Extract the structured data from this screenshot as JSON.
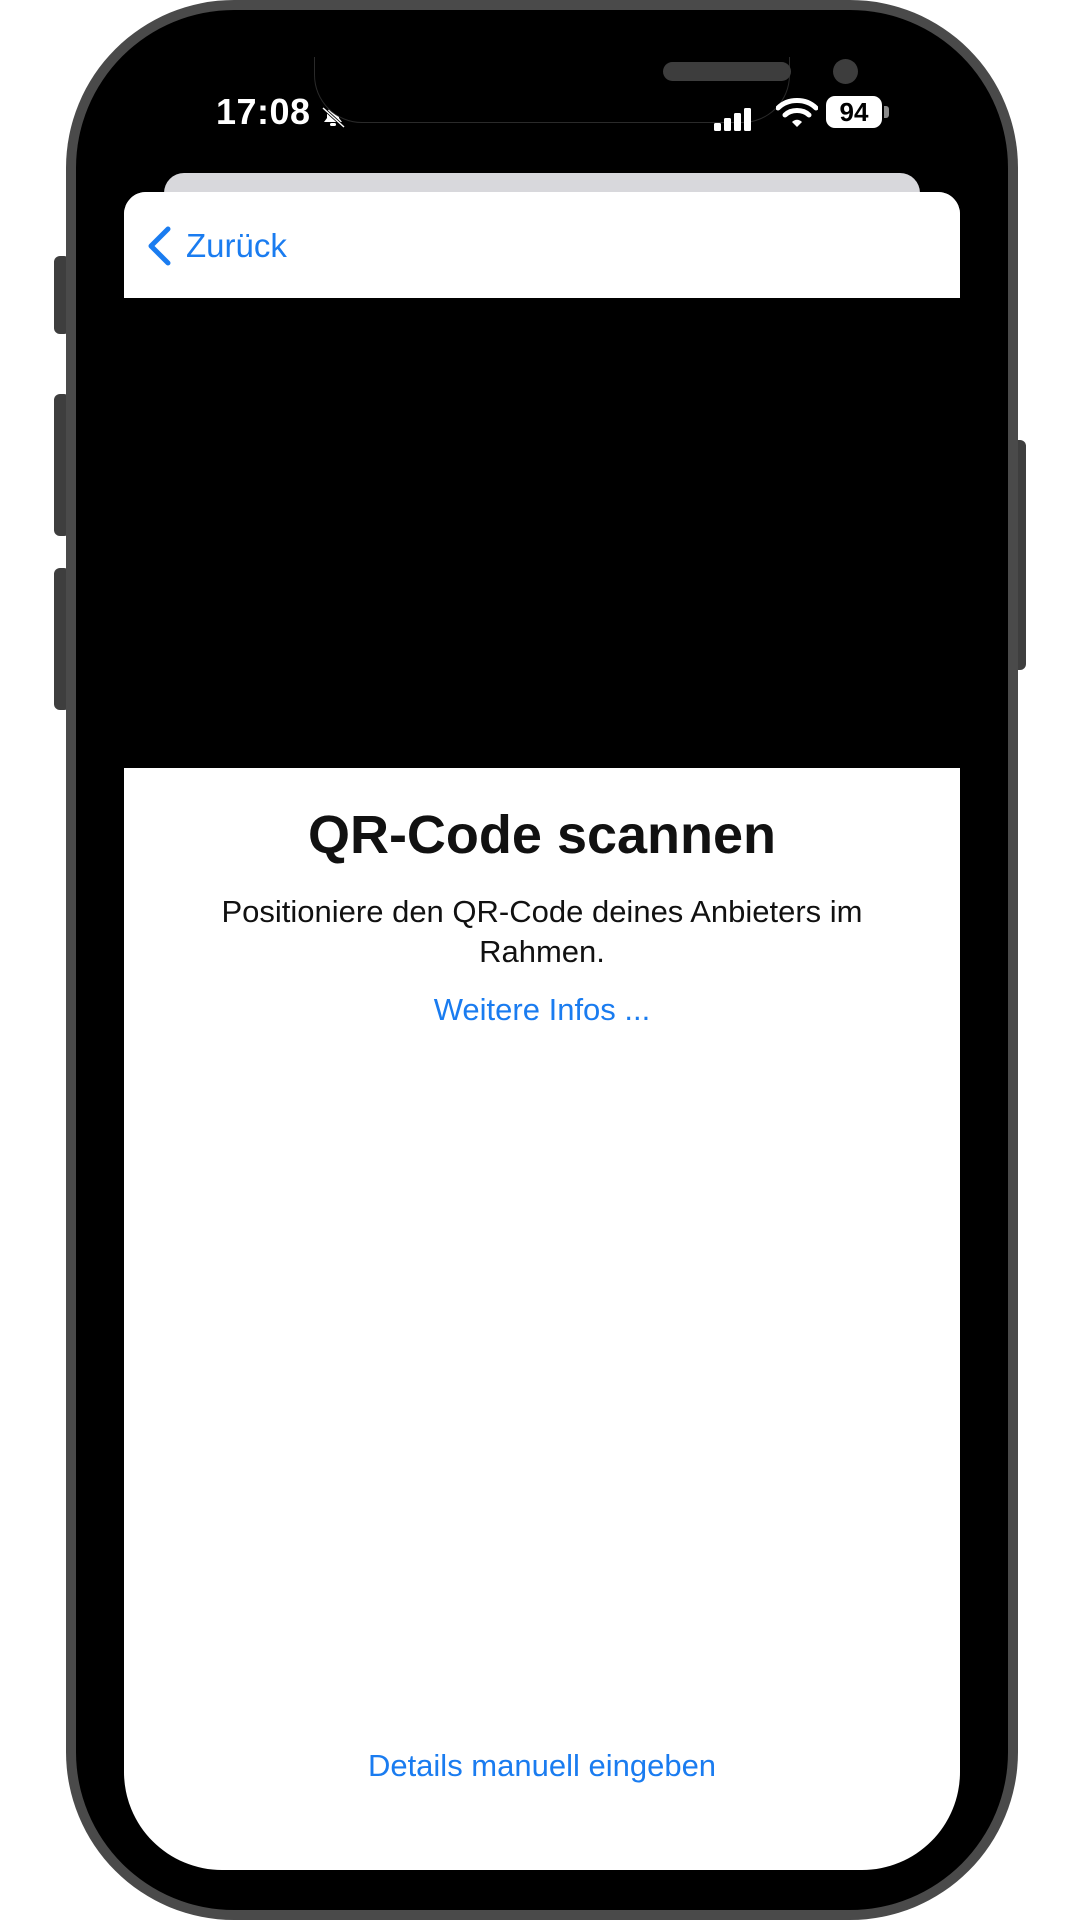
{
  "status_bar": {
    "time": "17:08",
    "battery_level": "94",
    "icons": [
      "bell-slash-icon",
      "cellular-signal-icon",
      "wifi-icon",
      "battery-icon"
    ]
  },
  "nav": {
    "back_label": "Zurück",
    "back_icon": "chevron-left-icon"
  },
  "scanner": {
    "title": "QR-Code scannen",
    "instruction": "Positioniere den QR-Code deines Anbieters im Rahmen.",
    "more_info_link": "Weitere Infos ...",
    "manual_entry_button": "Details manuell eingeben"
  },
  "colors": {
    "accent": "#1a7cf0",
    "camera_background": "#000000",
    "sheet_background": "#ffffff",
    "frame": "#4a4a4a"
  }
}
